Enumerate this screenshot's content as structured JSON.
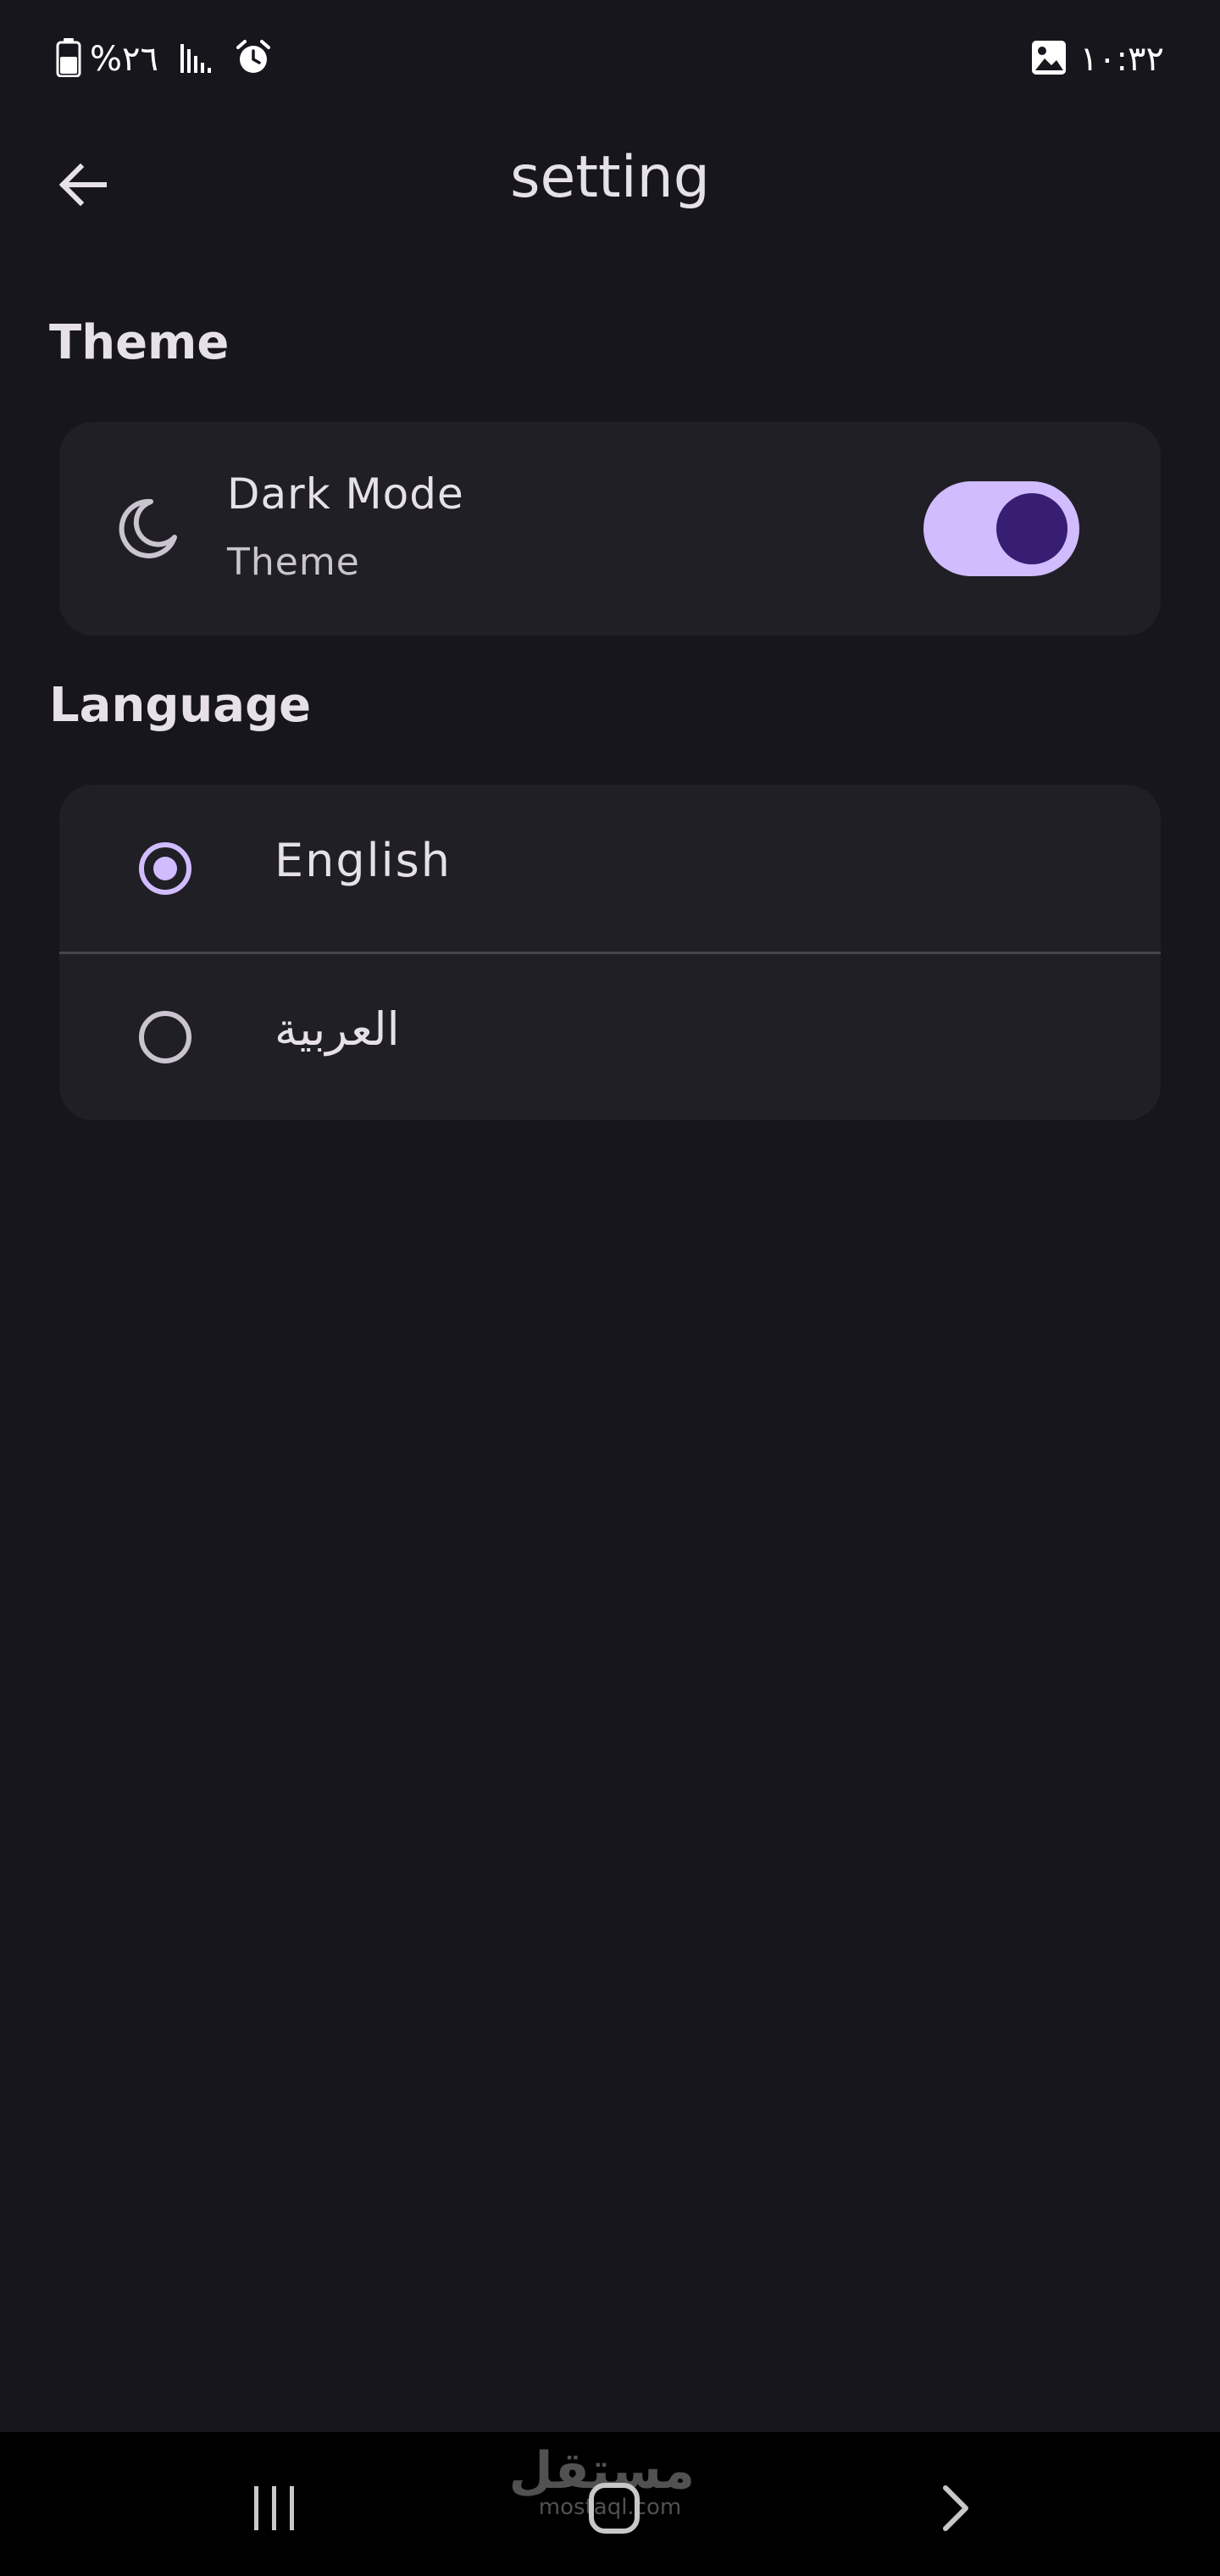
{
  "status_bar": {
    "battery_text": "%٢٦",
    "time": "١٠:٣٢",
    "icons": [
      "battery-icon",
      "signal-icon",
      "alarm-icon",
      "gallery-icon"
    ]
  },
  "app_bar": {
    "title": "setting",
    "back_icon": "arrow-back-icon"
  },
  "theme_section": {
    "heading": "Theme",
    "item": {
      "icon": "moon-icon",
      "title": "Dark Mode",
      "subtitle": "Theme",
      "switch_on": true
    }
  },
  "language_section": {
    "heading": "Language",
    "options": [
      {
        "label": "English",
        "selected": true
      },
      {
        "label": "العربية",
        "selected": false
      }
    ]
  },
  "nav_bar": {
    "watermark_ar": "مستقل",
    "watermark_en": "mostaql.com"
  },
  "colors": {
    "background": "#18161d",
    "card": "#211f26",
    "accent": "#d0bcff",
    "accent_dark": "#381e72",
    "text_primary": "#e6e1e9",
    "text_secondary": "#cac4d0"
  }
}
